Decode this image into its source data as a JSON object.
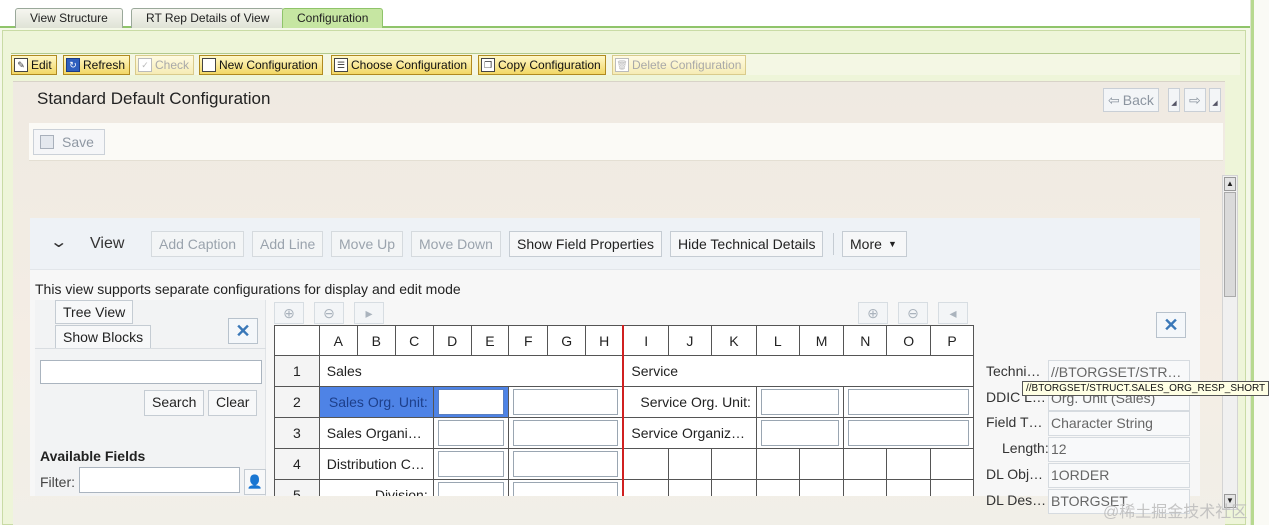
{
  "tabs": [
    {
      "label": "View Structure",
      "active": false
    },
    {
      "label": "RT Rep Details of View",
      "active": false
    },
    {
      "label": "Configuration",
      "active": true
    }
  ],
  "toolbar": {
    "edit": "Edit",
    "refresh": "Refresh",
    "check": "Check",
    "new_configuration": "New Configuration",
    "choose_configuration": "Choose Configuration",
    "copy_configuration": "Copy Configuration",
    "delete_configuration": "Delete Configuration"
  },
  "page": {
    "title": "Standard Default Configuration",
    "back_label": "Back",
    "save_label": "Save"
  },
  "view_bar": {
    "label": "View",
    "add_caption": "Add Caption",
    "add_line": "Add Line",
    "move_up": "Move Up",
    "move_down": "Move Down",
    "show_field_properties": "Show Field Properties",
    "hide_technical_details": "Hide Technical Details",
    "more": "More"
  },
  "info_text": "This view supports separate configurations for display and edit mode",
  "left_panel": {
    "tree_view": "Tree View",
    "show_blocks": "Show Blocks",
    "search_value": "",
    "search_btn": "Search",
    "clear_btn": "Clear",
    "available_fields": "Available Fields",
    "filter_label": "Filter:",
    "filter_value": ""
  },
  "grid": {
    "columns": [
      "A",
      "B",
      "C",
      "D",
      "E",
      "F",
      "G",
      "H",
      "I",
      "J",
      "K",
      "L",
      "M",
      "N",
      "O",
      "P"
    ],
    "rows": [
      "1",
      "2",
      "3",
      "4",
      "5"
    ],
    "sales_title": "Sales",
    "service_title": "Service",
    "sales_fields": [
      "Sales Org. Unit:",
      "Sales Organi…",
      "Distribution C…",
      "Division:"
    ],
    "service_fields": [
      "Service Org. Unit:",
      "Service Organiz…"
    ]
  },
  "properties": [
    {
      "label": "Techni…",
      "value": "//BTORGSET/STR…"
    },
    {
      "label": "DDIC L…",
      "value": "Org. Unit (Sales)"
    },
    {
      "label": "Field T…",
      "value": "Character String"
    },
    {
      "label": "Length:",
      "value": "12"
    },
    {
      "label": "DL Obj…",
      "value": "1ORDER"
    },
    {
      "label": "DL Des…",
      "value": "BTORGSET"
    }
  ],
  "tooltip": "//BTORGSET/STRUCT.SALES_ORG_RESP_SHORT",
  "watermark": "@稀土掘金技术社区",
  "colors": {
    "tab_active": "#c6e6a2",
    "toolbar_button": "#f2d765",
    "selected_cell": "#4e83e6",
    "block_divider": "#d02020"
  }
}
